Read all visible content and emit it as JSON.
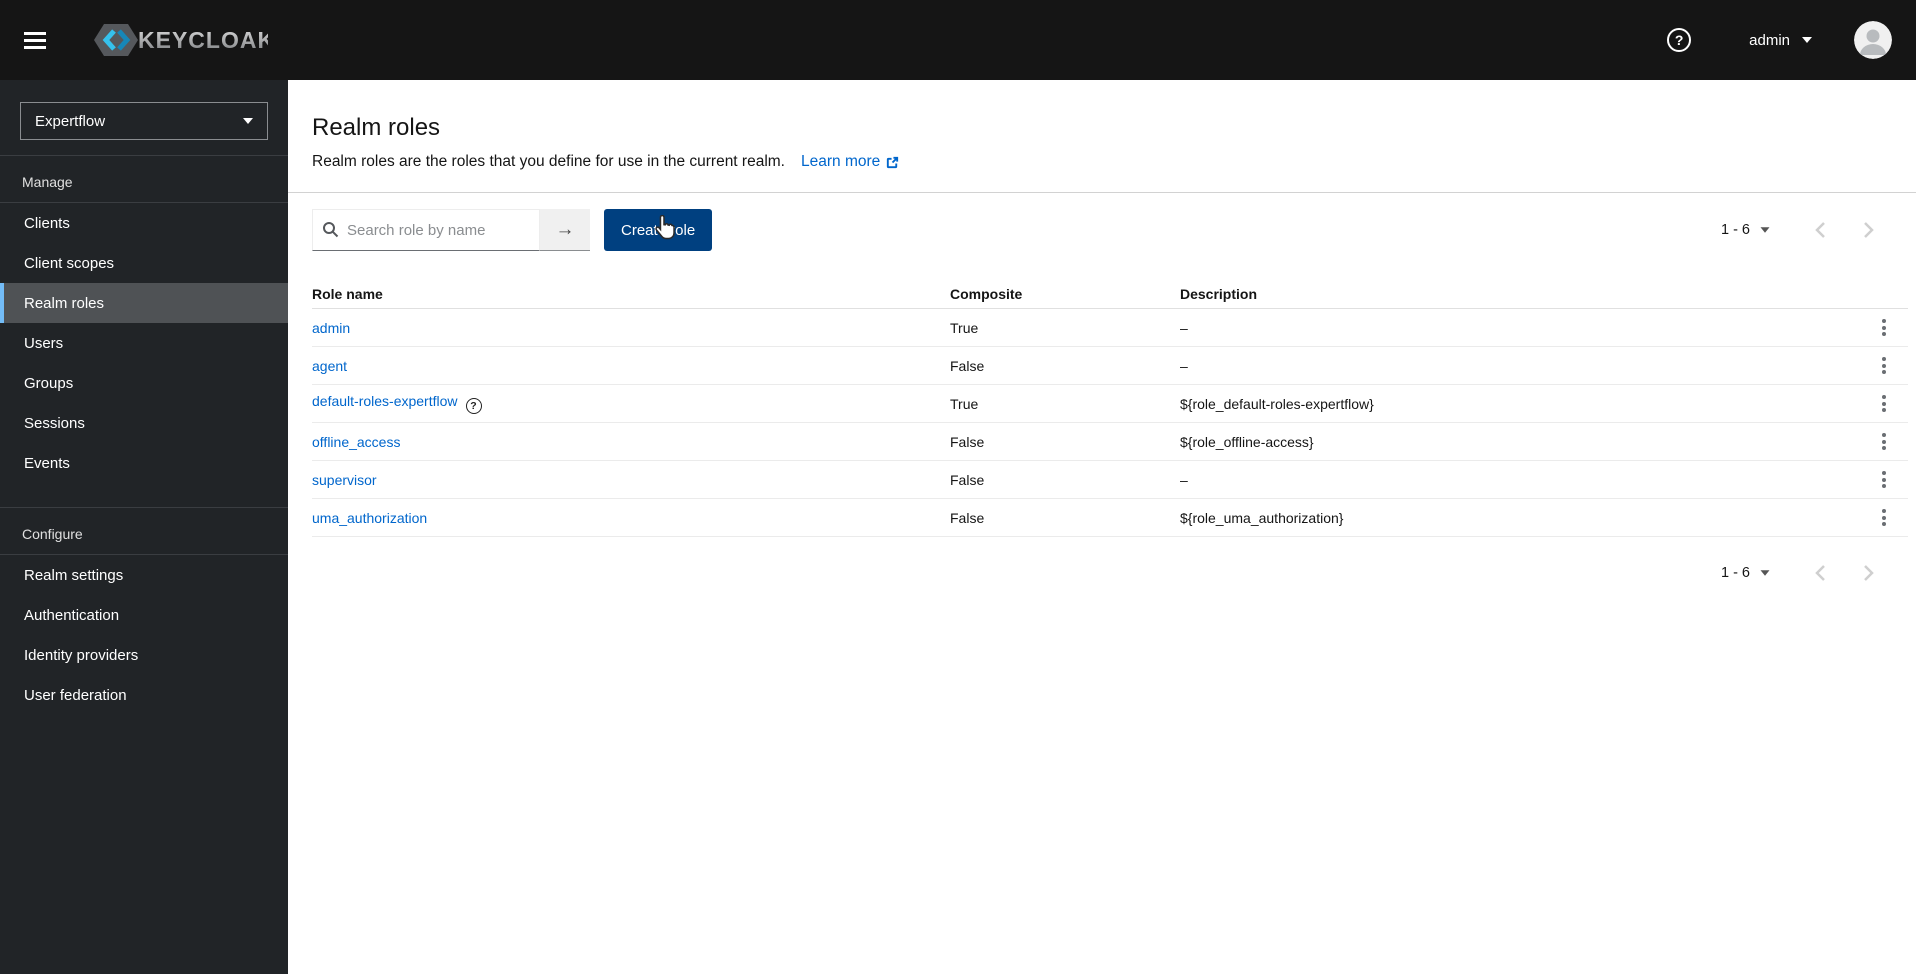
{
  "header": {
    "brand": "KEYCLOAK",
    "user": {
      "name": "admin"
    }
  },
  "sidebar": {
    "realm_selector": {
      "value": "Expertflow"
    },
    "sections": [
      {
        "label": "Manage",
        "items": [
          {
            "label": "Clients"
          },
          {
            "label": "Client scopes"
          },
          {
            "label": "Realm roles",
            "active": true
          },
          {
            "label": "Users"
          },
          {
            "label": "Groups"
          },
          {
            "label": "Sessions"
          },
          {
            "label": "Events"
          }
        ]
      },
      {
        "label": "Configure",
        "items": [
          {
            "label": "Realm settings"
          },
          {
            "label": "Authentication"
          },
          {
            "label": "Identity providers"
          },
          {
            "label": "User federation"
          }
        ]
      }
    ]
  },
  "main": {
    "title": "Realm roles",
    "description": "Realm roles are the roles that you define for use in the current realm.",
    "learn_more_label": "Learn more",
    "toolbar": {
      "search_placeholder": "Search role by name",
      "create_button_label": "Create role"
    },
    "pagination": {
      "range": "1 - 6"
    },
    "table": {
      "columns": [
        "Role name",
        "Composite",
        "Description"
      ],
      "rows": [
        {
          "name": "admin",
          "composite": "True",
          "description": "–",
          "has_help": false
        },
        {
          "name": "agent",
          "composite": "False",
          "description": "–",
          "has_help": false
        },
        {
          "name": "default-roles-expertflow",
          "composite": "True",
          "description": "${role_default-roles-expertflow}",
          "has_help": true
        },
        {
          "name": "offline_access",
          "composite": "False",
          "description": "${role_offline-access}",
          "has_help": false
        },
        {
          "name": "supervisor",
          "composite": "False",
          "description": "–",
          "has_help": false
        },
        {
          "name": "uma_authorization",
          "composite": "False",
          "description": "${role_uma_authorization}",
          "has_help": false
        }
      ]
    }
  },
  "colors": {
    "header_bg": "#151515",
    "sidebar_bg": "#212427",
    "sidebar_active_bg": "#4f5255",
    "sidebar_active_border": "#73bcf7",
    "link": "#0066cc",
    "primary_btn": "#004080",
    "text": "#151515",
    "muted": "#6a6e73",
    "border_light": "#ebebeb",
    "border_mid": "#d2d2d2"
  }
}
